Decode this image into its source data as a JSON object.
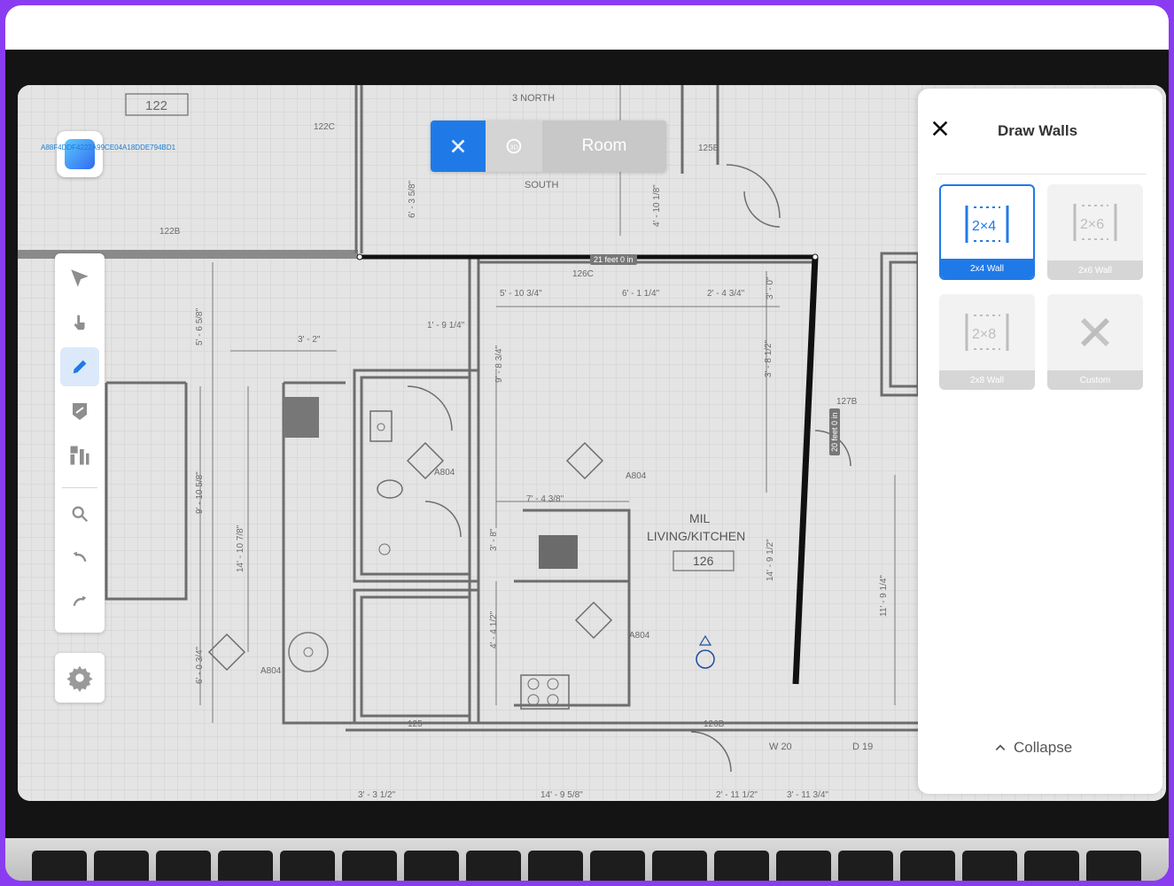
{
  "app": {
    "device_id": "A88F4DDF4222A99CE04A18DDE794BD1"
  },
  "mode_switcher": {
    "room_label": "Room"
  },
  "measurement": {
    "top_wall": "21 feet 0 in",
    "right_wall": "20 feet 0 in"
  },
  "plan_labels": {
    "room_name_line1": "MIL",
    "room_name_line2": "LIVING/KITCHEN",
    "room_number": "126",
    "room_122": "122",
    "tag_122c": "122C",
    "tag_122b": "122B",
    "tag_125b": "125B",
    "tag_126c": "126C",
    "tag_126b": "126B",
    "tag_127b": "127B",
    "tag_125": "125",
    "north": "3 NORTH",
    "south": "SOUTH",
    "dim_1": "5' - 10 3/4\"",
    "dim_2": "6' - 1 1/4\"",
    "dim_3": "2' - 4 3/4\"",
    "dim_4": "1' - 9 1/4\"",
    "dim_5": "3' - 2\"",
    "dim_6": "7' - 4 3/8\"",
    "dim_7": "9' - 8 3/4\"",
    "dim_8": "3' - 8 1/2\"",
    "dim_9": "14' - 9 1/2\"",
    "dim_10": "14' - 10 7/8\"",
    "dim_11": "9' - 10 5/8\"",
    "dim_12": "5' - 6 5/8\"",
    "dim_13": "6' - 0 3/4\"",
    "dim_14": "4' - 4 1/2\"",
    "dim_15": "3' - 8\"",
    "dim_16": "11' - 9 1/4\"",
    "dim_17": "6' - 3 5/8\"",
    "dim_18": "4' - 10 1/8\"",
    "dim_19": "3' - 0\"",
    "dim_20": "14' - 9 5/8\"",
    "dim_21": "2' - 11 1/2\"",
    "dim_22": "3' - 11 3/4\"",
    "dim_23": "3' - 3 1/2\"",
    "tag_a804_1": "A804",
    "tag_a804_2": "A804",
    "tag_a804_3": "A804",
    "tag_a804_4": "A804",
    "tag_w20": "W 20",
    "tag_d19": "D 19"
  },
  "panel": {
    "title": "Draw Walls",
    "cards": [
      {
        "label": "2x4 Wall",
        "glyph": "2×4",
        "selected": true
      },
      {
        "label": "2x6 Wall",
        "glyph": "2×6",
        "selected": false
      },
      {
        "label": "2x8 Wall",
        "glyph": "2×8",
        "selected": false
      },
      {
        "label": "Custom",
        "glyph": "",
        "selected": false
      }
    ],
    "collapse_label": "Collapse"
  },
  "colors": {
    "accent": "#1f7ae8",
    "border": "#8a3cf0"
  }
}
